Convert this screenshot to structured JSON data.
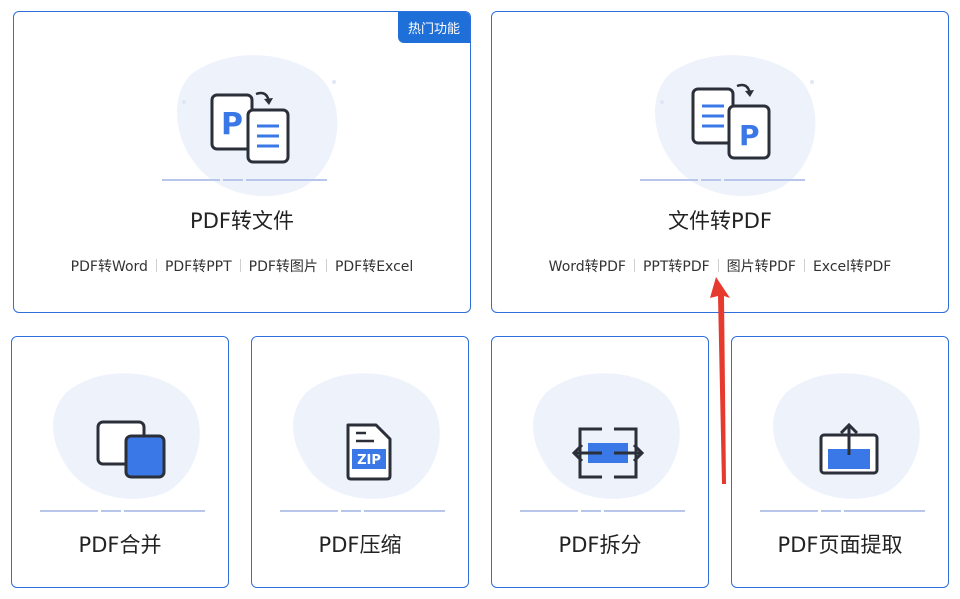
{
  "cards": {
    "pdf_to_file": {
      "badge": "热门功能",
      "title": "PDF转文件",
      "links": [
        "PDF转Word",
        "PDF转PPT",
        "PDF转图片",
        "PDF转Excel"
      ]
    },
    "file_to_pdf": {
      "title": "文件转PDF",
      "links": [
        "Word转PDF",
        "PPT转PDF",
        "图片转PDF",
        "Excel转PDF"
      ]
    },
    "merge": {
      "title": "PDF合并"
    },
    "compress": {
      "title": "PDF压缩",
      "icon_text": "ZIP"
    },
    "split": {
      "title": "PDF拆分"
    },
    "extract": {
      "title": "PDF页面提取"
    }
  },
  "colors": {
    "accent": "#2f6fdc",
    "icon_blue": "#3b78e7",
    "badge": "#1f6fd8",
    "annotation_arrow": "#e63a2e"
  },
  "icons": {
    "pdf_to_file": "pdf-to-doc-icon",
    "file_to_pdf": "doc-to-pdf-icon",
    "merge": "merge-pages-icon",
    "compress": "zip-file-icon",
    "split": "split-arrows-icon",
    "extract": "export-page-icon"
  }
}
